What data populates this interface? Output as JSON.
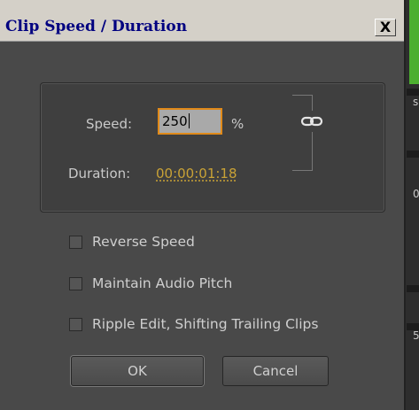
{
  "window": {
    "title": "Clip Speed / Duration",
    "close_glyph": "X"
  },
  "speed": {
    "label": "Speed:",
    "value": "250",
    "unit": "%",
    "link_icon": "chain-link-icon"
  },
  "duration": {
    "label": "Duration:",
    "value": "00:00:01:18"
  },
  "options": [
    {
      "label": "Reverse Speed",
      "checked": false
    },
    {
      "label": "Maintain Audio Pitch",
      "checked": false
    },
    {
      "label": "Ripple Edit, Shifting Trailing Clips",
      "checked": false
    }
  ],
  "buttons": {
    "ok": "OK",
    "cancel": "Cancel"
  },
  "background": {
    "chars": [
      "s",
      "0",
      "5"
    ]
  },
  "colors": {
    "accent": "#e08a1a",
    "timecode": "#c9a236",
    "title": "#000080"
  }
}
